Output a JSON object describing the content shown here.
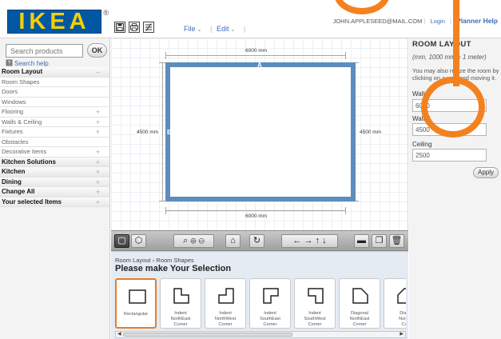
{
  "brand": {
    "logo_text": "IKEA",
    "reg_mark": "®",
    "colors": {
      "blue": "#0058a3",
      "yellow": "#f6ce03",
      "accent": "#e87d2a"
    }
  },
  "header": {
    "menus": [
      {
        "label": "File"
      },
      {
        "label": "Edit"
      }
    ],
    "toolbar_icons": [
      "save-icon",
      "print-icon",
      "settings-icon"
    ],
    "user_email": "JOHN.APPLESEED@MAIL.COM",
    "login_label": "Login",
    "planner_help_label": "Planner Help"
  },
  "sidebar": {
    "search_placeholder": "Search products",
    "ok_label": "OK",
    "search_help_label": "Search help",
    "sections": [
      {
        "label": "Room Layout",
        "type": "header",
        "sign": "–"
      },
      {
        "label": "Room Shapes",
        "type": "item",
        "sign": ""
      },
      {
        "label": "Doors",
        "type": "item",
        "sign": ""
      },
      {
        "label": "Windows",
        "type": "item",
        "sign": ""
      },
      {
        "label": "Flooring",
        "type": "item",
        "sign": "+"
      },
      {
        "label": "Walls & Ceiling",
        "type": "item",
        "sign": "+"
      },
      {
        "label": "Fixtures",
        "type": "item",
        "sign": "+"
      },
      {
        "label": "Obstacles",
        "type": "item",
        "sign": ""
      },
      {
        "label": "Decorative Items",
        "type": "item",
        "sign": "+"
      },
      {
        "label": "Kitchen Solutions",
        "type": "header",
        "sign": "+"
      },
      {
        "label": "Kitchen",
        "type": "header",
        "sign": "+"
      },
      {
        "label": "Dining",
        "type": "header",
        "sign": "+"
      },
      {
        "label": "Change All",
        "type": "header",
        "sign": "+"
      },
      {
        "label": "Your selected Items",
        "type": "header",
        "sign": "+"
      }
    ]
  },
  "room": {
    "wall_a_label": "A",
    "wall_b_label": "B",
    "top_dim": "6000 mm",
    "bottom_dim": "6000 mm",
    "left_dim": "4500 mm",
    "right_dim": "4500 mm",
    "wall_color": "#5b8dbd"
  },
  "toolbar": {
    "tools": [
      "floor-plan-view",
      "3d-view",
      "zoom-fit",
      "zoom-in",
      "zoom-out",
      "home",
      "rotate",
      "arrow-left",
      "arrow-right",
      "arrow-up",
      "arrow-down",
      "measure",
      "copy",
      "delete"
    ]
  },
  "picker": {
    "breadcrumb": "Room Layout › Room Shapes",
    "title": "Please make Your Selection",
    "shapes": [
      {
        "label": "Rectangular",
        "selected": true
      },
      {
        "label": "Indent\nNorthEast\nCorner",
        "selected": false
      },
      {
        "label": "Indent\nNorthWest\nCorner",
        "selected": false
      },
      {
        "label": "Indent\nSouthEast\nCorner",
        "selected": false
      },
      {
        "label": "Indent\nSouthWest\nCorner",
        "selected": false
      },
      {
        "label": "Diagonal\nNorthEast\nCorner",
        "selected": false
      },
      {
        "label": "Diag\nNorth\nCo",
        "selected": false
      }
    ]
  },
  "panel": {
    "title": "ROOM LAYOUT",
    "note": "(mm, 1000 mm = 1 meter)",
    "desc": "You may also resize the room by clicking on a wall and moving it.",
    "fields": [
      {
        "label": "Wall A",
        "value": "6000"
      },
      {
        "label": "Wall B",
        "value": "4500"
      },
      {
        "label": "Ceiling",
        "value": "2500"
      }
    ],
    "apply_label": "Apply"
  }
}
